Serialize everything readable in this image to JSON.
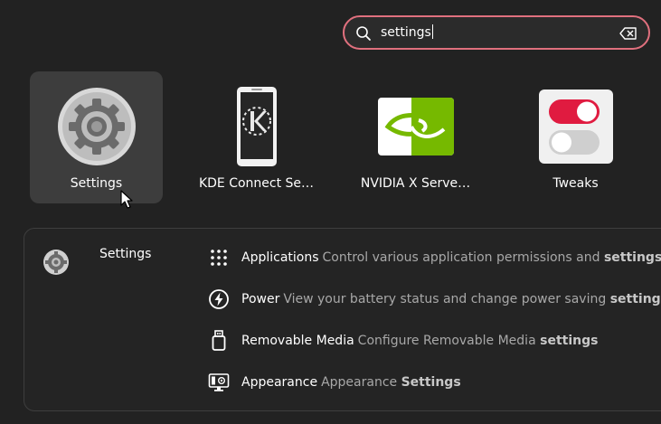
{
  "search": {
    "query": "settings",
    "search_icon": "search-icon",
    "clear_icon": "clear-text-icon"
  },
  "apps": [
    {
      "label": "Settings",
      "icon": "settings-gear-icon",
      "selected": true
    },
    {
      "label": "KDE Connect Se…",
      "icon": "kde-connect-icon",
      "selected": false
    },
    {
      "label": "NVIDIA X Serve…",
      "icon": "nvidia-icon",
      "selected": false
    },
    {
      "label": "Tweaks",
      "icon": "tweaks-toggle-icon",
      "selected": false
    }
  ],
  "provider": {
    "label": "Settings",
    "icon": "settings-gear-icon"
  },
  "results": [
    {
      "title": "Applications",
      "desc_pre": "Control various application permissions and",
      "desc_bold": "settings",
      "icon": "app-grid-icon"
    },
    {
      "title": "Power",
      "desc_pre": "View your battery status and change power saving",
      "desc_bold": "settings",
      "icon": "power-icon"
    },
    {
      "title": "Removable Media",
      "desc_pre": "Configure Removable Media",
      "desc_bold": "settings",
      "icon": "usb-drive-icon"
    },
    {
      "title": "Appearance",
      "desc_pre": "Appearance",
      "desc_bold": "Settings",
      "icon": "appearance-icon"
    }
  ],
  "colors": {
    "background": "#222222",
    "search_border": "#e0707e",
    "selected_tile": "#3d3d3d",
    "nvidia_green": "#76b900",
    "toggle_on": "#e01b40"
  }
}
